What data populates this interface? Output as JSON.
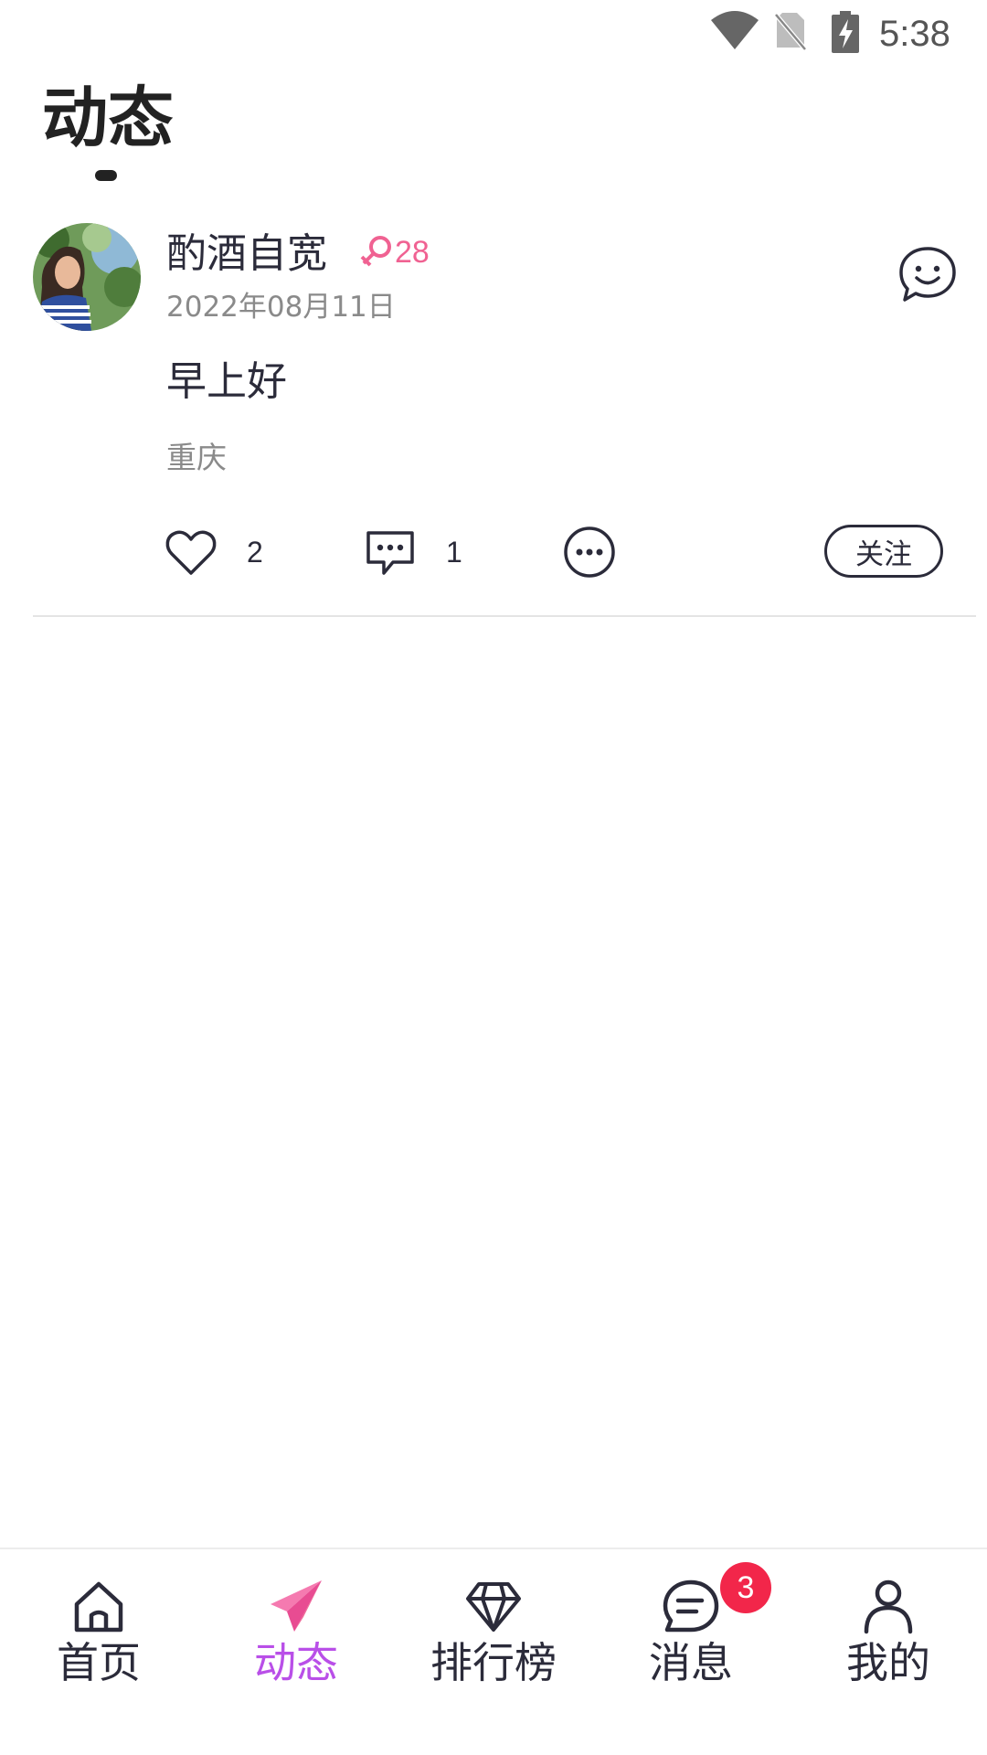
{
  "status_bar": {
    "time": "5:38",
    "icons": [
      "wifi-icon",
      "no-sim-icon",
      "battery-charging-icon"
    ]
  },
  "header": {
    "title": "动态"
  },
  "post": {
    "username": "酌酒自宽",
    "gender": "female",
    "age": "28",
    "date": "2022年08月11日",
    "content": "早上好",
    "location": "重庆",
    "likes": "2",
    "comments": "1",
    "follow_label": "关注"
  },
  "colors": {
    "accent": "#b94fe8",
    "pink": "#f06292",
    "badge": "#f2264a",
    "text": "#2b2b3a"
  },
  "bottom_nav": {
    "items": [
      {
        "label": "首页",
        "icon": "home-icon"
      },
      {
        "label": "动态",
        "icon": "paper-plane-icon",
        "active": true
      },
      {
        "label": "排行榜",
        "icon": "diamond-icon"
      },
      {
        "label": "消息",
        "icon": "message-icon",
        "badge": "3"
      },
      {
        "label": "我的",
        "icon": "profile-icon"
      }
    ]
  }
}
